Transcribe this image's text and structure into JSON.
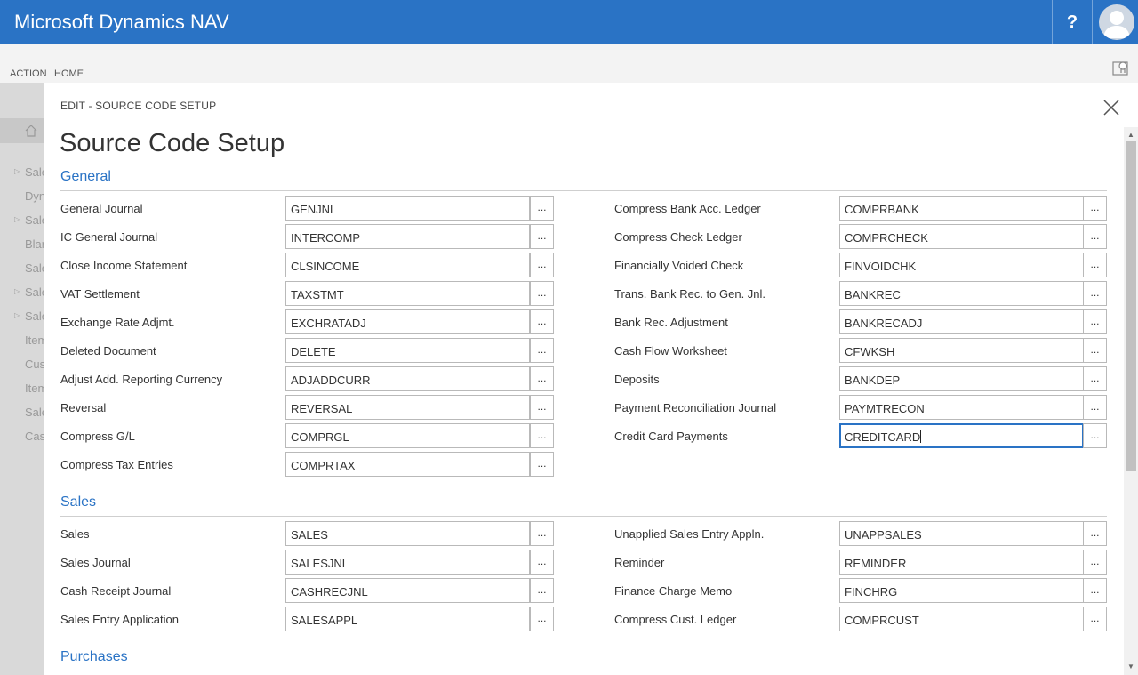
{
  "app": {
    "title": "Microsoft Dynamics NAV",
    "help_label": "?"
  },
  "ribbon": {
    "actions_label": "ACTION",
    "home_label": "HOME"
  },
  "background_nav": {
    "items": [
      "Sale",
      "Dyn",
      "Sale",
      "Blar",
      "Sale",
      "Sale",
      "Sale",
      "Item",
      "Cus",
      "Item",
      "Sale",
      "Cas"
    ]
  },
  "dialog": {
    "breadcrumb": "EDIT - SOURCE CODE SETUP",
    "title": "Source Code Setup",
    "lookup_label": "...",
    "sections": {
      "general": {
        "title": "General",
        "left": [
          {
            "label": "General Journal",
            "value": "GENJNL"
          },
          {
            "label": "IC General Journal",
            "value": "INTERCOMP"
          },
          {
            "label": "Close Income Statement",
            "value": "CLSINCOME"
          },
          {
            "label": "VAT Settlement",
            "value": "TAXSTMT"
          },
          {
            "label": "Exchange Rate Adjmt.",
            "value": "EXCHRATADJ"
          },
          {
            "label": "Deleted Document",
            "value": "DELETE"
          },
          {
            "label": "Adjust Add. Reporting Currency",
            "value": "ADJADDCURR"
          },
          {
            "label": "Reversal",
            "value": "REVERSAL"
          },
          {
            "label": "Compress G/L",
            "value": "COMPRGL"
          },
          {
            "label": "Compress Tax Entries",
            "value": "COMPRTAX"
          }
        ],
        "right": [
          {
            "label": "Compress Bank Acc. Ledger",
            "value": "COMPRBANK"
          },
          {
            "label": "Compress Check Ledger",
            "value": "COMPRCHECK"
          },
          {
            "label": "Financially Voided Check",
            "value": "FINVOIDCHK"
          },
          {
            "label": "Trans. Bank Rec. to Gen. Jnl.",
            "value": "BANKREC"
          },
          {
            "label": "Bank Rec. Adjustment",
            "value": "BANKRECADJ"
          },
          {
            "label": "Cash Flow Worksheet",
            "value": "CFWKSH"
          },
          {
            "label": "Deposits",
            "value": "BANKDEP"
          },
          {
            "label": "Payment Reconciliation Journal",
            "value": "PAYMTRECON"
          },
          {
            "label": "Credit Card Payments",
            "value": "CREDITCARD"
          }
        ]
      },
      "sales": {
        "title": "Sales",
        "left": [
          {
            "label": "Sales",
            "value": "SALES"
          },
          {
            "label": "Sales Journal",
            "value": "SALESJNL"
          },
          {
            "label": "Cash Receipt Journal",
            "value": "CASHRECJNL"
          },
          {
            "label": "Sales Entry Application",
            "value": "SALESAPPL"
          }
        ],
        "right": [
          {
            "label": "Unapplied Sales Entry Appln.",
            "value": "UNAPPSALES"
          },
          {
            "label": "Reminder",
            "value": "REMINDER"
          },
          {
            "label": "Finance Charge Memo",
            "value": "FINCHRG"
          },
          {
            "label": "Compress Cust. Ledger",
            "value": "COMPRCUST"
          }
        ]
      },
      "purchases": {
        "title": "Purchases"
      }
    }
  },
  "colors": {
    "accent": "#2a73c5",
    "appbar": "#2a73c5"
  }
}
